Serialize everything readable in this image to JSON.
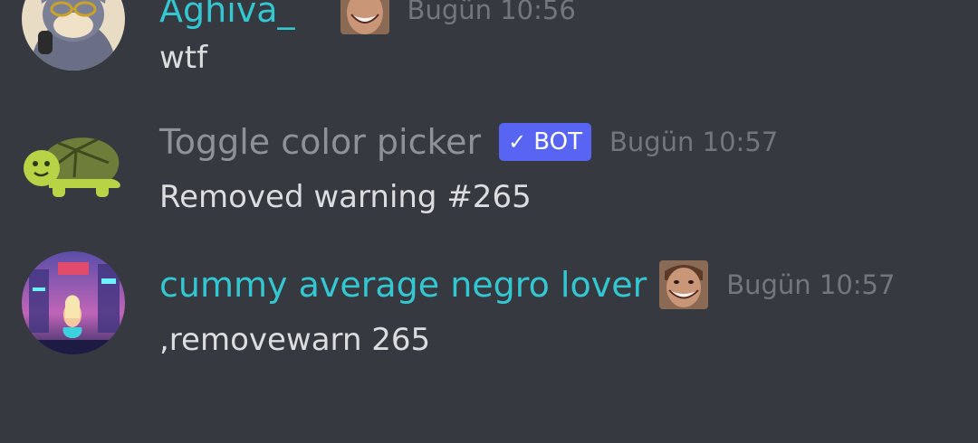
{
  "colors": {
    "background": "#36393f",
    "username_teal": "#33c7d1",
    "username_gray": "#8e9297",
    "timestamp": "#72767d",
    "message_text": "#dcddde",
    "bot_tag": "#5865f2"
  },
  "messages": [
    {
      "username": "Aghiva_",
      "timestamp": "Bugün 10:56",
      "content": "wtf",
      "avatar_icon": "cartoon-cat-avatar-icon",
      "emote_icon": "grinning-face-emote-icon"
    },
    {
      "username": "Toggle color picker",
      "bot_tag": "BOT",
      "bot_check": "✓",
      "timestamp": "Bugün 10:57",
      "content": "Removed warning #265",
      "avatar_icon": "turtle-avatar-icon"
    },
    {
      "username": "cummy average negro lover",
      "timestamp": "Bugün 10:57",
      "content": ",removewarn 265",
      "avatar_icon": "neon-city-avatar-icon",
      "emote_icon": "grinning-face-emote-icon"
    }
  ]
}
